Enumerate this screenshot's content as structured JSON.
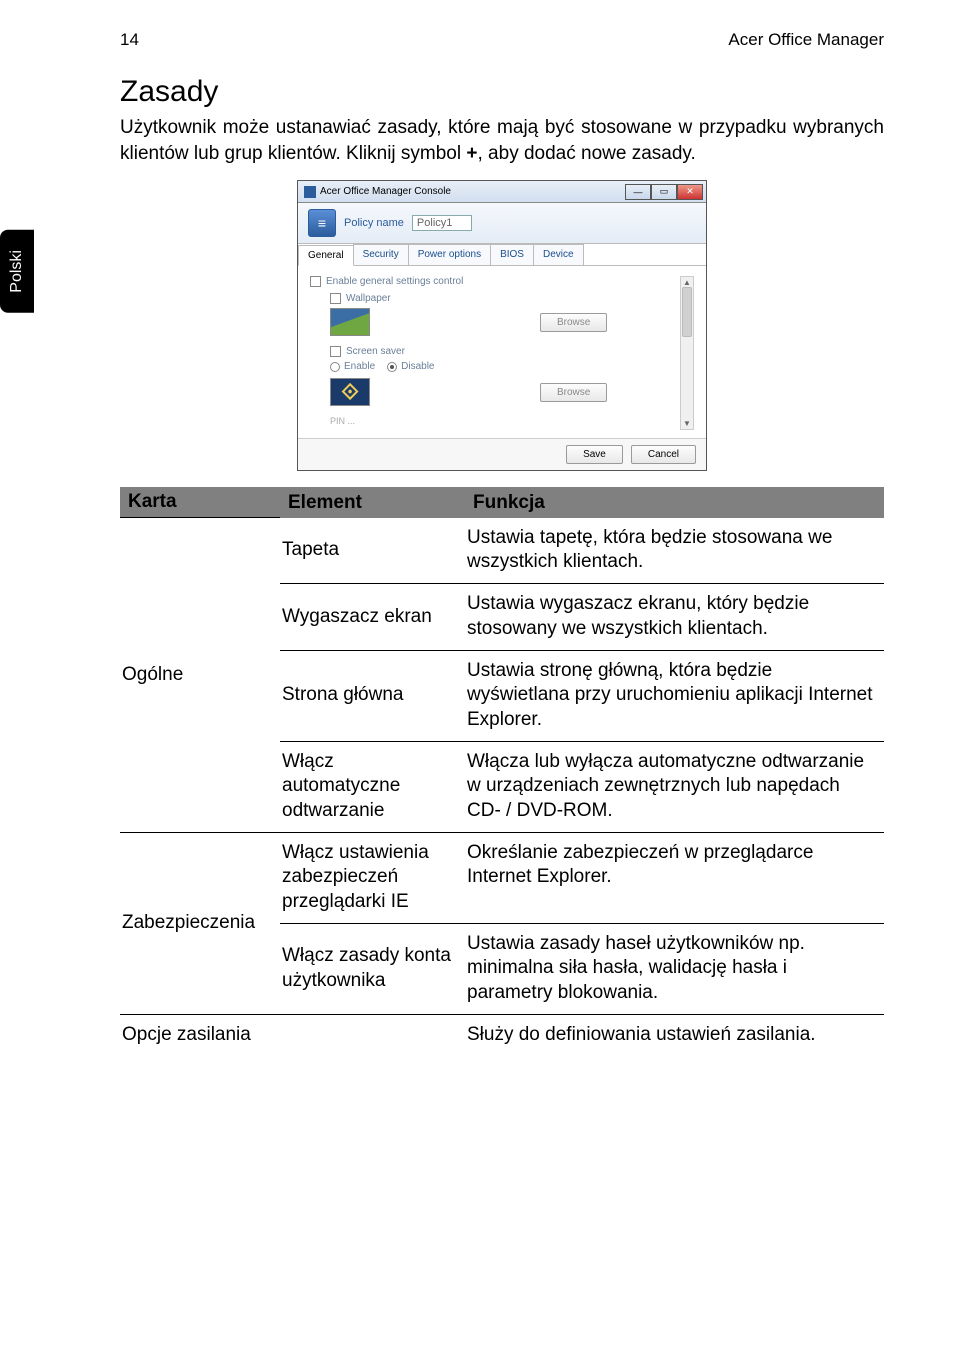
{
  "header": {
    "page_number": "14",
    "title": "Acer Office Manager"
  },
  "side_tab": "Polski",
  "section_title": "Zasady",
  "intro_html": "Użytkownik może ustanawiać zasady, które mają być stosowane w przypadku wybranych klientów lub grup klientów. Kliknij symbol +, aby dodać nowe zasady.",
  "app": {
    "title": "Acer Office Manager Console",
    "policy_label": "Policy name",
    "policy_value": "Policy1",
    "tabs": {
      "general": "General",
      "security": "Security",
      "power": "Power options",
      "bios": "BIOS",
      "device": "Device"
    },
    "enable_label": "Enable general settings control",
    "wallpaper_label": "Wallpaper",
    "browse_label": "Browse",
    "screensaver_label": "Screen saver",
    "enable_radio": "Enable",
    "disable_radio": "Disable",
    "pin": "PIN ...",
    "save": "Save",
    "cancel": "Cancel"
  },
  "table": {
    "headers": {
      "karta": "Karta",
      "element": "Element",
      "funkcja": "Funkcja"
    },
    "groups": [
      {
        "karta": "Ogólne",
        "rows": [
          {
            "element": "Tapeta",
            "funkcja": "Ustawia tapetę, która będzie stosowana we wszystkich klientach."
          },
          {
            "element": "Wygaszacz ekran",
            "funkcja": "Ustawia wygaszacz ekranu, który będzie stosowany we wszystkich klientach."
          },
          {
            "element": "Strona główna",
            "funkcja": "Ustawia stronę główną, która będzie wyświetlana przy uruchomieniu aplikacji Internet Explorer."
          },
          {
            "element": "Włącz automatyczne odtwarzanie",
            "funkcja": "Włącza lub wyłącza automatyczne odtwarzanie w urządzeniach zewnętrznych lub napędach CD- / DVD-ROM."
          }
        ]
      },
      {
        "karta": "Zabezpieczenia",
        "rows": [
          {
            "element": "Włącz ustawienia zabezpieczeń przeglądarki IE",
            "funkcja": "Określanie zabezpieczeń w przeglądarce Internet Explorer."
          },
          {
            "element": "Włącz zasady konta użytkownika",
            "funkcja": "Ustawia zasady haseł użytkowników np. minimalna siła hasła, walidację hasła i parametry blokowania."
          }
        ]
      },
      {
        "karta": "Opcje zasilania",
        "rows": [
          {
            "element": "",
            "funkcja": "Służy do definiowania ustawień zasilania."
          }
        ]
      }
    ]
  }
}
